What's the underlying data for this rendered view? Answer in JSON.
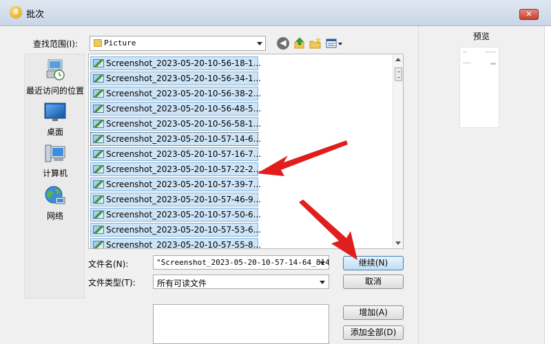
{
  "window": {
    "title": "批次",
    "close_label": "✕"
  },
  "lookin": {
    "label": "查找范围(I):",
    "value": "Picture"
  },
  "places": [
    {
      "id": "recent",
      "label": "最近访问的位置"
    },
    {
      "id": "desktop",
      "label": "桌面"
    },
    {
      "id": "computer",
      "label": "计算机"
    },
    {
      "id": "network",
      "label": "网络"
    }
  ],
  "files": [
    "Screenshot_2023-05-20-10-56-18-1...",
    "Screenshot_2023-05-20-10-56-34-1...",
    "Screenshot_2023-05-20-10-56-38-2...",
    "Screenshot_2023-05-20-10-56-48-5...",
    "Screenshot_2023-05-20-10-56-58-1...",
    "Screenshot_2023-05-20-10-57-14-6...",
    "Screenshot_2023-05-20-10-57-16-7...",
    "Screenshot_2023-05-20-10-57-22-2...",
    "Screenshot_2023-05-20-10-57-39-7...",
    "Screenshot_2023-05-20-10-57-46-9...",
    "Screenshot_2023-05-20-10-57-50-6...",
    "Screenshot_2023-05-20-10-57-53-6...",
    "Screenshot_2023-05-20-10-57-55-8..."
  ],
  "focused_file_index": 5,
  "filename": {
    "label": "文件名(N):",
    "value": "\"Screenshot_2023-05-20-10-57-14-64_8142"
  },
  "filetype": {
    "label": "文件类型(T):",
    "value": "所有可读文件"
  },
  "buttons": {
    "continue": "继续(N)",
    "cancel": "取消",
    "add": "增加(A)",
    "add_all": "添加全部(D)"
  },
  "preview": {
    "label": "预览"
  },
  "colors": {
    "annotation_arrow": "#e01e1e",
    "selection": "#cde4f7",
    "primary_button": "#bfdcf3"
  }
}
